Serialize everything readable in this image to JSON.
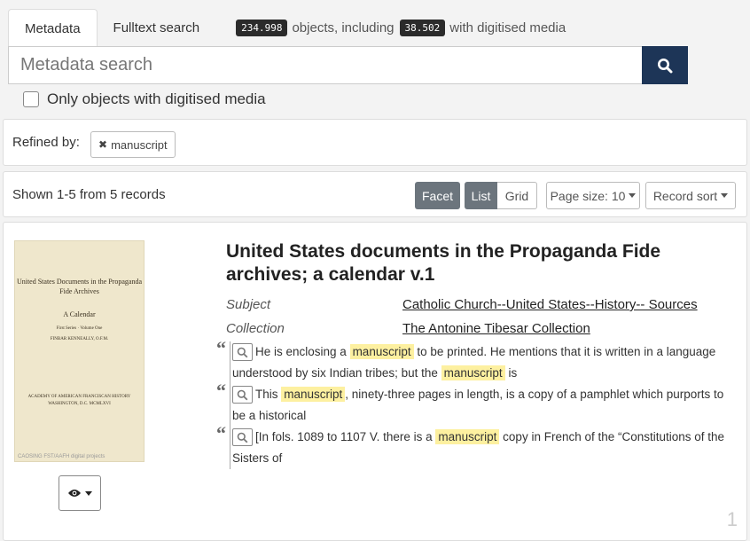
{
  "tabs": [
    {
      "label": "Metadata",
      "active": true
    },
    {
      "label": "Fulltext search",
      "active": false
    }
  ],
  "counts": {
    "objects": "234.998",
    "objects_text": "objects, including",
    "media": "38.502",
    "media_text": "with digitised media"
  },
  "search": {
    "placeholder": "Metadata search",
    "button_icon": "search-icon"
  },
  "digitised_filter": {
    "label": "Only objects with digitised media",
    "checked": false
  },
  "refined": {
    "label": "Refined by:",
    "filters": [
      {
        "label": "manuscript",
        "remove_icon": "times-icon"
      }
    ]
  },
  "results": {
    "shown": "Shown 1-5 from 5 records",
    "facet": "Facet",
    "list": "List",
    "grid": "Grid",
    "page_size": "Page size: 10",
    "sort": "Record sort"
  },
  "record": {
    "title": "United States documents in the Propaganda Fide archives; a calendar v.1",
    "thumbnail": {
      "line1": "United States Documents in the Propaganda Fide Archives",
      "line2": "A Calendar",
      "line3": "First Series  ·  Volume One",
      "line4": "FINBAR KENNEALLY, O.F.M.",
      "line5": "ACADEMY OF AMERICAN FRANCISCAN HISTORY WASHINGTON, D.C. MCMLXVI",
      "credit": "CAOSING FST/AAFH digital projects"
    },
    "view_icon": "eye-icon",
    "subject_label": "Subject",
    "subject_value": "Catholic Church--United States--History-- Sources",
    "collection_label": "Collection",
    "collection_value": "The Antonine Tibesar Collection",
    "snippets": [
      {
        "pre": "He is enclosing a ",
        "hit": "manuscript",
        "mid": " to be printed. He mentions that it is written in a language understood by six Indian tribes; but the ",
        "hit2": "manuscript",
        "post": " is"
      },
      {
        "pre": "This ",
        "hit": "manuscript",
        "post": ", ninety-three pages in length, is a copy of a pamphlet which purports to be a historical"
      },
      {
        "pre": "[In fols. 1089 to 1107 V. there is a ",
        "hit": "manuscript",
        "post": " copy in French of the “Constitutions of the Sisters of"
      }
    ],
    "number": "1"
  },
  "colors": {
    "search_button": "#1d3557",
    "highlight": "#fdf0a0",
    "active_toggle": "#6c757d"
  }
}
